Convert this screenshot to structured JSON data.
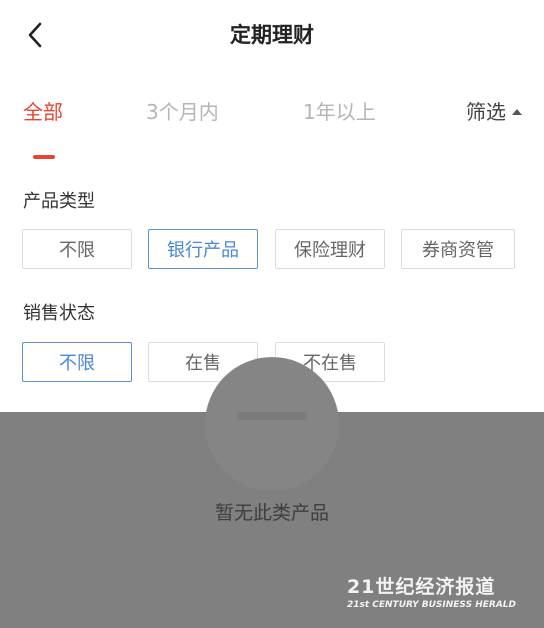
{
  "header": {
    "title": "定期理财",
    "back_icon": "chevron-left-icon"
  },
  "tabs": [
    {
      "label": "全部",
      "active": true
    },
    {
      "label": "3个月内",
      "active": false
    },
    {
      "label": "1年以上",
      "active": false
    }
  ],
  "filter": {
    "label": "筛选",
    "icon": "caret-up-icon"
  },
  "filter_panel": {
    "product_type": {
      "label": "产品类型",
      "options": [
        {
          "label": "不限",
          "selected": false
        },
        {
          "label": "银行产品",
          "selected": true
        },
        {
          "label": "保险理财",
          "selected": false
        },
        {
          "label": "券商资管",
          "selected": false
        }
      ]
    },
    "sale_status": {
      "label": "销售状态",
      "options": [
        {
          "label": "不限",
          "selected": true
        },
        {
          "label": "在售",
          "selected": false
        },
        {
          "label": "不在售",
          "selected": false
        }
      ]
    }
  },
  "empty_state": {
    "text": "暂无此类产品",
    "icon": "empty-box-icon"
  },
  "watermark": {
    "main": "21世纪经济报道",
    "sub": "21st CENTURY BUSINESS HERALD"
  },
  "colors": {
    "accent": "#e8452f",
    "selected_border": "#5a8ed6",
    "overlay": "#808080"
  }
}
